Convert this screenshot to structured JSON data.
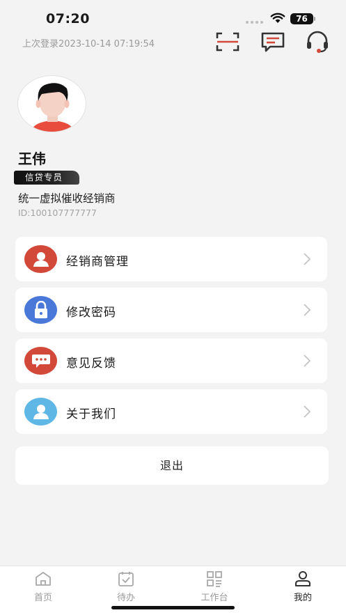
{
  "status_bar": {
    "time": "07:20",
    "battery": "76"
  },
  "header": {
    "last_login": "上次登录2023-10-14 07:19:54"
  },
  "profile": {
    "name": "王伟",
    "role": "信贷专员",
    "company": "统一虚拟催收经销商",
    "user_id": "ID:100107777777"
  },
  "menu": [
    {
      "label": "经销商管理",
      "icon": "dealer-user-icon",
      "color": "#d2493a"
    },
    {
      "label": "修改密码",
      "icon": "lock-icon",
      "color": "#4a78d8"
    },
    {
      "label": "意见反馈",
      "icon": "feedback-chat-icon",
      "color": "#d2493a"
    },
    {
      "label": "关于我们",
      "icon": "about-user-icon",
      "color": "#5fb7e6"
    }
  ],
  "logout_label": "退出",
  "tabbar": [
    {
      "label": "首页",
      "icon": "home-icon"
    },
    {
      "label": "待办",
      "icon": "todo-calendar-icon"
    },
    {
      "label": "工作台",
      "icon": "workbench-grid-icon"
    },
    {
      "label": "我的",
      "icon": "profile-icon",
      "active": true
    }
  ],
  "colors": {
    "accent": "#d2493a",
    "background": "#f3f3f3"
  }
}
